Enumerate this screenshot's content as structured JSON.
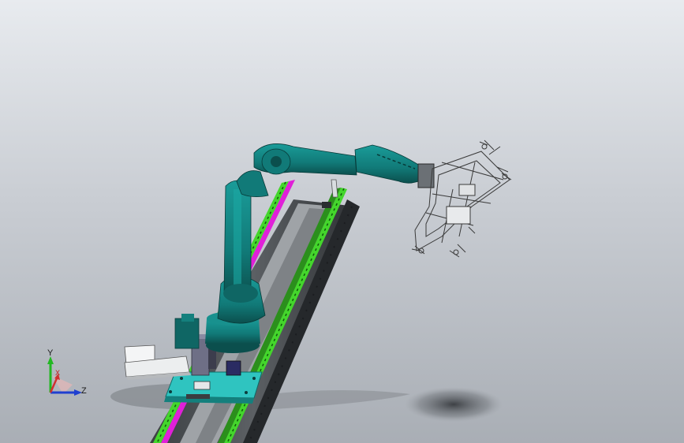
{
  "viewport": {
    "background_top": "#e8ebef",
    "background_bottom": "#a9aeb5"
  },
  "model": {
    "robot_color": "#117a78",
    "robot_dark": "#0b4f4d",
    "rail_color": "#4d5154",
    "rail_light": "#8c9094",
    "rack_green": "#44d62c",
    "rack_magenta": "#e020d8",
    "base_plate_color": "#2fc4c0"
  },
  "triad": {
    "x_label": "X",
    "y_label": "Y",
    "z_label": "Z",
    "x_color": "#d03030",
    "y_color": "#22b822",
    "z_color": "#2040d0"
  }
}
